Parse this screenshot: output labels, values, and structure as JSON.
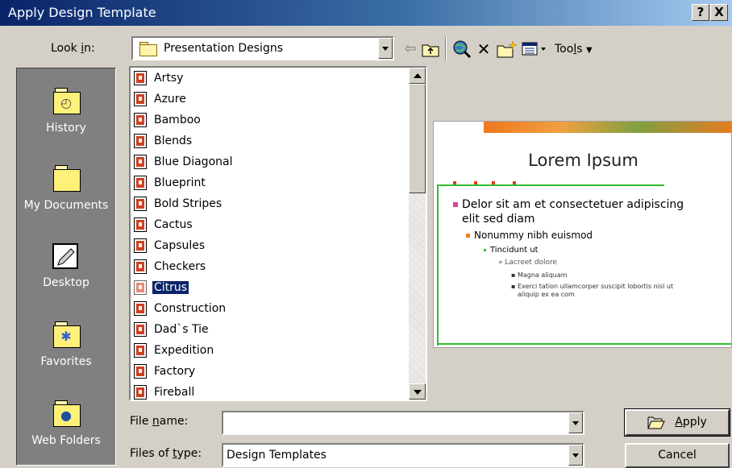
{
  "window": {
    "title": "Apply Design Template",
    "help_label": "?",
    "close_label": "X"
  },
  "lookin": {
    "label": "Look in:",
    "label_pre": "Look ",
    "label_key": "i",
    "label_post": "n:",
    "value": "Presentation Designs",
    "icon": "folder-icon"
  },
  "toolbar": {
    "tools_label": "Tools",
    "tools_pre": "Too",
    "tools_key": "l",
    "tools_post": "s",
    "back_glyph": "⇦",
    "delete_glyph": "✕"
  },
  "places": [
    {
      "label": "History",
      "icon": "history-icon"
    },
    {
      "label": "My Documents",
      "icon": "my-documents-icon"
    },
    {
      "label": "Desktop",
      "icon": "desktop-icon"
    },
    {
      "label": "Favorites",
      "icon": "favorites-icon"
    },
    {
      "label": "Web Folders",
      "icon": "web-folders-icon"
    }
  ],
  "files": [
    "Artsy",
    "Azure",
    "Bamboo",
    "Blends",
    "Blue Diagonal",
    "Blueprint",
    "Bold Stripes",
    "Cactus",
    "Capsules",
    "Checkers",
    "Citrus",
    "Construction",
    "Dad`s Tie",
    "Expedition",
    "Factory",
    "Fireball"
  ],
  "selected_file": "Citrus",
  "preview": {
    "title": "Lorem Ipsum",
    "bullet1_line1": "Delor sit am et consectetuer adipiscing",
    "bullet1_line2": "elit sed diam",
    "bullet2": "Nonummy nibh euismod",
    "bullet3": "Tincidunt ut",
    "bullet4": "Lacreet dolore",
    "bullet5": "Magna aliquam",
    "bullet6_line1": "Exerci tation ullamcorper suscipit lobortis nisl ut",
    "bullet6_line2": "aliquip ex ea com"
  },
  "filename": {
    "label_pre": "File ",
    "label_key": "n",
    "label_post": "ame:",
    "value": ""
  },
  "filetype": {
    "label_pre": "Files of ",
    "label_key": "t",
    "label_post": "ype:",
    "value": "Design Templates"
  },
  "buttons": {
    "apply_key": "A",
    "apply_post": "pply",
    "cancel": "Cancel"
  }
}
